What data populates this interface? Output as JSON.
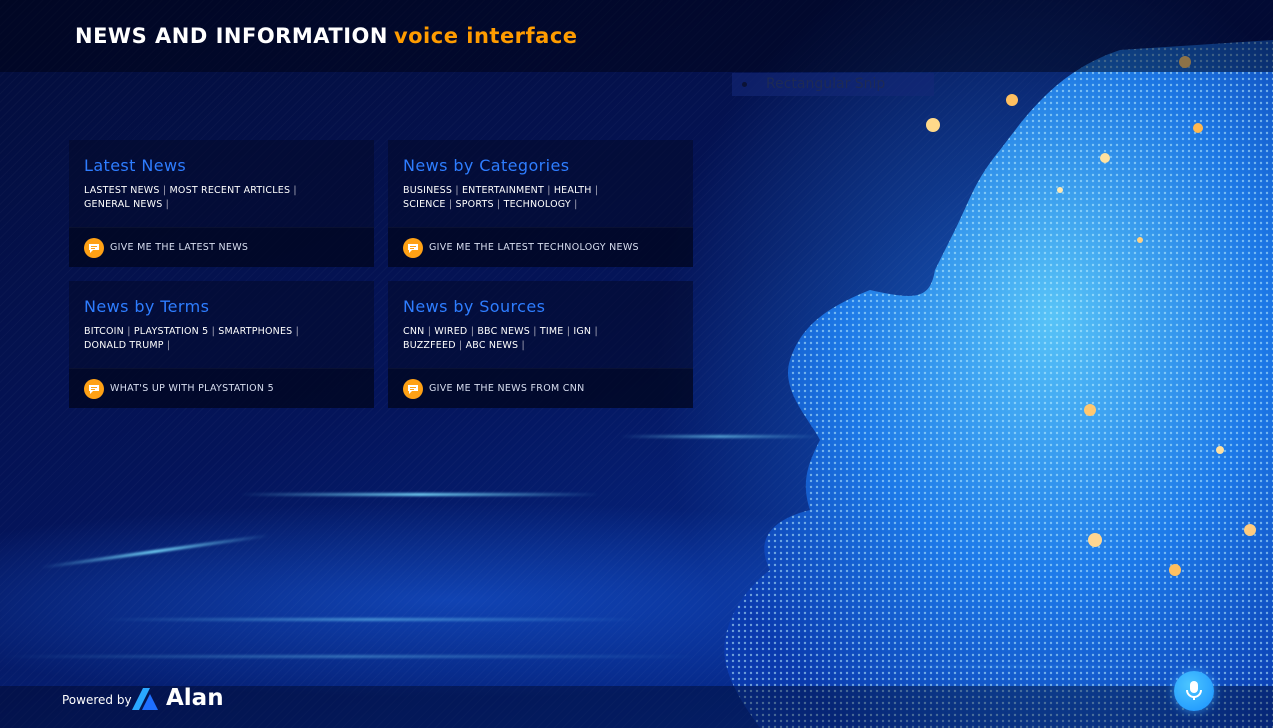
{
  "header": {
    "title": "NEWS AND INFORMATION",
    "subtitle": "voice interface"
  },
  "snip_tool": {
    "label": "Rectangular Snip"
  },
  "cards": [
    {
      "title": "Latest News",
      "links": [
        "LASTEST NEWS",
        "MOST RECENT ARTICLES",
        "GENERAL NEWS"
      ],
      "command": "GIVE ME THE LATEST NEWS"
    },
    {
      "title": "News by Categories",
      "links": [
        "BUSINESS",
        "ENTERTAINMENT",
        "HEALTH",
        "SCIENCE",
        "SPORTS",
        "TECHNOLOGY"
      ],
      "command": "GIVE ME THE LATEST TECHNOLOGY NEWS"
    },
    {
      "title": "News by Terms",
      "links": [
        "BITCOIN",
        "PLAYSTATION 5",
        "SMARTPHONES",
        "DONALD TRUMP"
      ],
      "command": "WHAT'S UP WITH PLAYSTATION 5"
    },
    {
      "title": "News by Sources",
      "links": [
        "CNN",
        "WIRED",
        "BBC NEWS",
        "TIME",
        "IGN",
        "BUZZFEED",
        "ABC NEWS"
      ],
      "command": "GIVE ME THE NEWS FROM CNN"
    }
  ],
  "footer": {
    "powered_by": "Powered by",
    "brand": "Alan"
  },
  "icons": {
    "command_bubble": "chat-bubble-icon",
    "mic": "microphone-icon",
    "logo": "alan-logo-icon"
  },
  "colors": {
    "accent": "#ff9c00",
    "card_title": "#2e7dff",
    "mic": "#1890ff"
  }
}
